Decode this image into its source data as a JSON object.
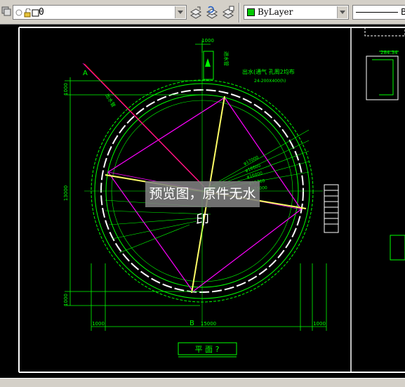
{
  "toolbar": {
    "layer_name": "0",
    "color_name": "ByLayer",
    "linetype_label": "B",
    "colors": {
      "bylayer_swatch": "#00c800"
    }
  },
  "drawing": {
    "title": "平   面   ?",
    "top_dim": "1000",
    "left_dims": [
      "1000",
      "13000",
      "1000"
    ],
    "bottom_dims": [
      "1000",
      "15000",
      "1000"
    ],
    "axis_a": "A",
    "axis_b": "B",
    "note_top": "出水(通气 孔周2均布",
    "note_top2": "24-200X400(h)",
    "vent_label": "进水管",
    "left_label": "出水管",
    "section_value": "284.34",
    "radius_labels": [
      "φ17000",
      "φ16600",
      "φ16000",
      "φ15760",
      "φ15000"
    ],
    "colors": {
      "background": "#000000",
      "lines": "#00ff00",
      "magenta": "#ff00ff",
      "yellow": "#ffff66",
      "red": "#ff2020",
      "white": "#ffffff"
    }
  },
  "watermark": "预览图，原件无水印"
}
